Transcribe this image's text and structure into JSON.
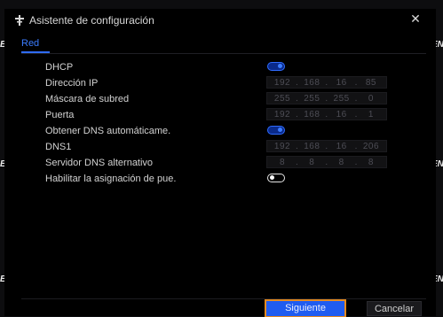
{
  "window": {
    "title": "Asistente de configuración",
    "close_glyph": "✕"
  },
  "tabs": [
    {
      "label": "Red",
      "active": true
    }
  ],
  "background_edge_text": {
    "left": "E",
    "right": "EN"
  },
  "fields": {
    "dhcp": {
      "label": "DHCP",
      "toggle": "on"
    },
    "ip": {
      "label": "Dirección IP",
      "value": [
        "192",
        "168",
        "16",
        "85"
      ]
    },
    "mask": {
      "label": "Máscara de subred",
      "value": [
        "255",
        "255",
        "255",
        "0"
      ]
    },
    "gateway": {
      "label": "Puerta",
      "value": [
        "192",
        "168",
        "16",
        "1"
      ]
    },
    "auto_dns": {
      "label": "Obtener DNS automáticame.",
      "toggle": "on"
    },
    "dns1": {
      "label": "DNS1",
      "value": [
        "192",
        "168",
        "16",
        "206"
      ]
    },
    "dns2": {
      "label": "Servidor DNS alternativo",
      "value": [
        "8",
        "8",
        "8",
        "8"
      ]
    },
    "port_mapping": {
      "label": "Habilitar la asignación de pue.",
      "toggle": "off"
    }
  },
  "buttons": {
    "next": "Siguiente",
    "cancel": "Cancelar"
  },
  "colors": {
    "accent": "#2f6cff",
    "highlight_border": "#e58a1f"
  },
  "icons": {
    "title": "network-port-icon",
    "close": "close-icon"
  }
}
